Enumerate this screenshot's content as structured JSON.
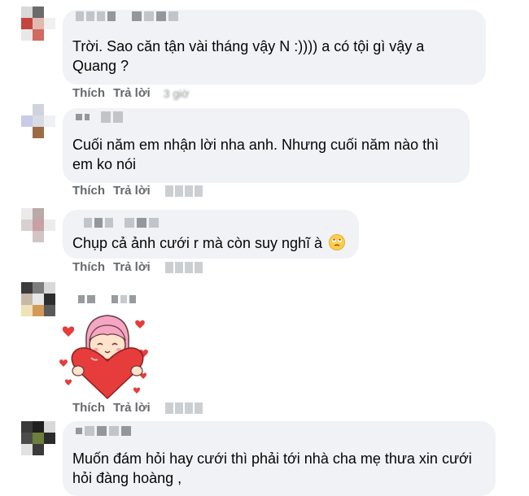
{
  "comments": [
    {
      "text": "Trời. Sao căn tận vài tháng vậy N :)))) a có tội gì vậy a Quang ?",
      "actions": {
        "like": "Thích",
        "reply": "Trả lời"
      },
      "timestamp": "3 giờ"
    },
    {
      "text": "Cuối năm em nhận lời nha anh. Nhưng cuối năm nào thì em ko nói",
      "actions": {
        "like": "Thích",
        "reply": "Trả lời"
      }
    },
    {
      "text": "Chụp cả ảnh cưới r mà còn suy nghĩ à",
      "emoji": "rolling-eyes-emoji",
      "actions": {
        "like": "Thích",
        "reply": "Trả lời"
      }
    },
    {
      "sticker": "girl-hugging-heart-sticker",
      "actions": {
        "like": "Thích",
        "reply": "Trả lời"
      }
    },
    {
      "text": "Muốn đám hỏi hay cưới thì phải tới nhà cha mẹ thưa xin cưới hỏi đàng hoàng ,"
    }
  ],
  "colors": {
    "bubble": "#f0f2f5",
    "action_text": "#65676b",
    "sticker_heart": "#e63c3c",
    "sticker_hair": "#f4a6c4"
  }
}
